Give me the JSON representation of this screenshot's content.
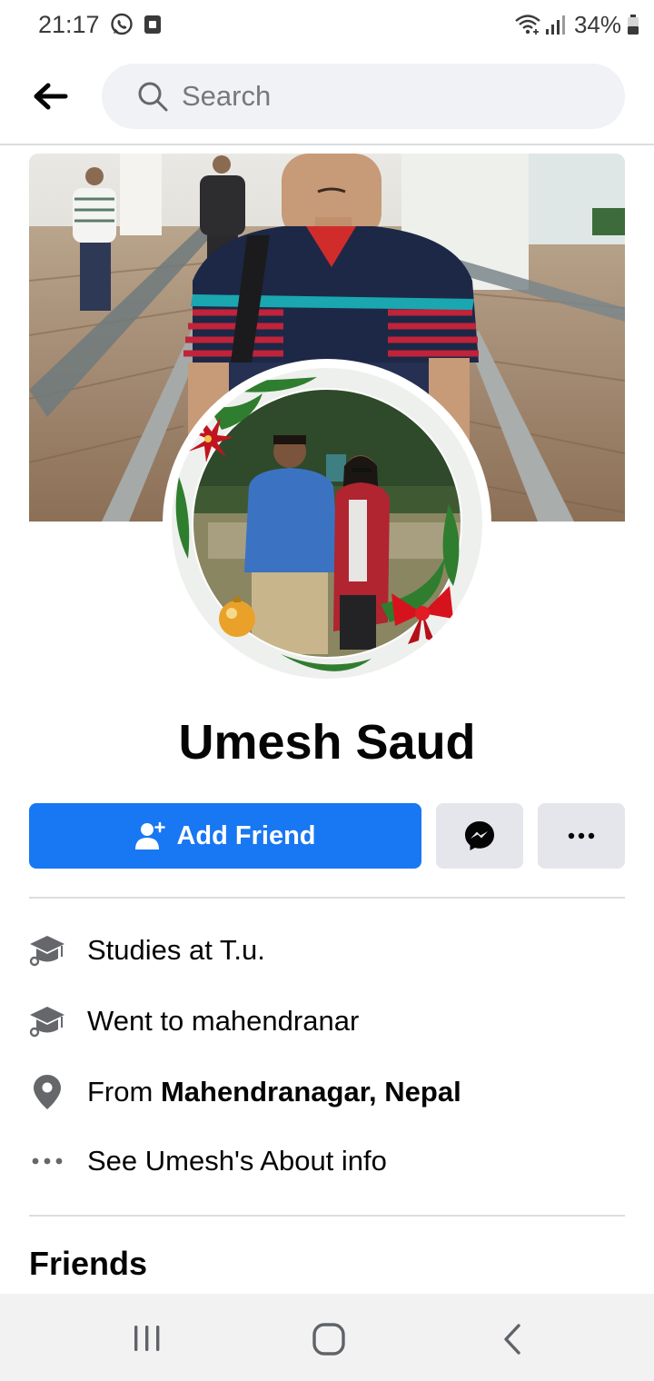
{
  "status_bar": {
    "time": "21:17",
    "battery": "34%",
    "icons": [
      "whatsapp-icon",
      "app-notification-icon",
      "wifi-icon",
      "signal-icon",
      "battery-icon"
    ]
  },
  "header": {
    "back_icon": "back-arrow-icon",
    "search": {
      "placeholder": "Search",
      "icon": "search-icon"
    }
  },
  "profile": {
    "name": "Umesh Saud",
    "cover_photo": "cover-photo",
    "profile_picture": "profile-picture"
  },
  "actions": {
    "add_friend_label": "Add Friend",
    "add_friend_icon": "add-friend-icon",
    "message_icon": "messenger-icon",
    "more_icon": "more-options-icon"
  },
  "details": [
    {
      "icon": "graduation-cap-icon",
      "text": "Studies at T.u."
    },
    {
      "icon": "graduation-cap-icon",
      "text": "Went to mahendranar"
    },
    {
      "icon": "location-pin-icon",
      "prefix": "From ",
      "bold": "Mahendranagar, Nepal"
    },
    {
      "icon": "more-dots-icon",
      "text": "See Umesh's About info"
    }
  ],
  "friends": {
    "title": "Friends"
  },
  "nav_bar": {
    "icons": [
      "recent-apps-icon",
      "home-icon",
      "back-icon"
    ]
  },
  "colors": {
    "primary_blue": "#1877f2",
    "secondary_button": "#e4e6eb",
    "search_background": "#f0f2f5",
    "divider": "#dadde1",
    "icon_gray": "#65676b"
  }
}
